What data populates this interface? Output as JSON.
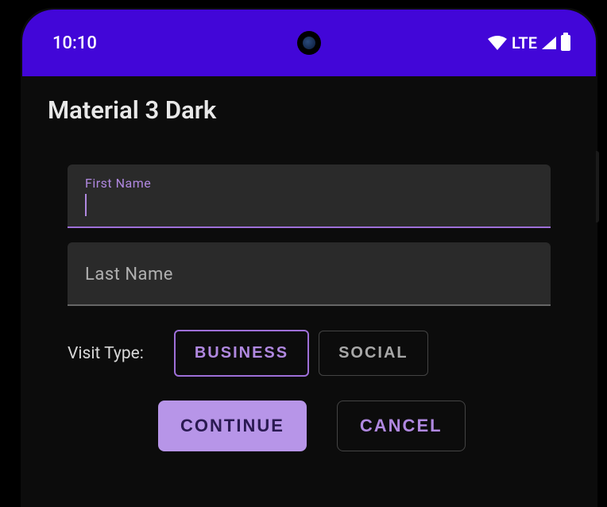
{
  "status": {
    "time": "10:10",
    "network": "LTE"
  },
  "title": "Material 3 Dark",
  "form": {
    "first_name": {
      "label": "First Name",
      "value": ""
    },
    "last_name": {
      "label": "Last Name",
      "value": ""
    },
    "visit_type": {
      "label": "Visit Type:",
      "options": {
        "business": "BUSINESS",
        "social": "SOCIAL"
      },
      "selected": "business"
    }
  },
  "buttons": {
    "continue": "CONTINUE",
    "cancel": "CANCEL"
  },
  "colors": {
    "status_bar": "#4206d8",
    "background": "#0c0c0c",
    "field_bg": "#2a2a2a",
    "accent": "#b088e0",
    "primary_btn": "#b795e8"
  }
}
